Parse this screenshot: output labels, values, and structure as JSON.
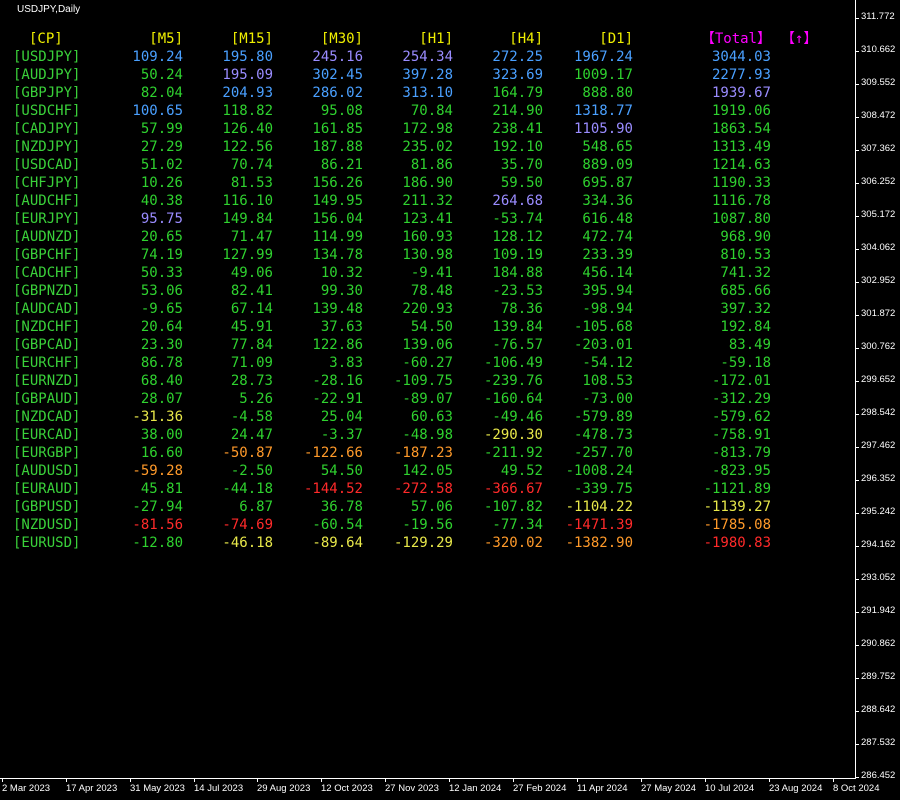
{
  "window": {
    "title": "USDJPY,Daily"
  },
  "colors": {
    "pair": "#3ad13a",
    "hdr_tf": "#f0f000",
    "hdr_total": "#ff00ff",
    "blue": "#4aa0ff",
    "purple": "#9a8cff",
    "green": "#2fd22f",
    "yellow": "#e8e84a",
    "orange": "#ff9a2a",
    "red": "#ff2a2a",
    "axis": "#ffffff"
  },
  "table": {
    "pair_header": "[CP]",
    "headers": [
      "[M5]",
      "[M15]",
      "[M30]",
      "[H1]",
      "[H4]",
      "[D1]",
      "【Total】"
    ],
    "arrow_header": "【↑】",
    "rows": [
      {
        "pair": "[USDJPY]",
        "v": [
          "109.24",
          "195.80",
          "245.16",
          "254.34",
          "272.25",
          "1967.24",
          "3044.03"
        ],
        "c": [
          "blue",
          "blue",
          "purple",
          "purple",
          "blue",
          "blue",
          "blue"
        ]
      },
      {
        "pair": "[AUDJPY]",
        "v": [
          "50.24",
          "195.09",
          "302.45",
          "397.28",
          "323.69",
          "1009.17",
          "2277.93"
        ],
        "c": [
          "green",
          "purple",
          "blue",
          "blue",
          "blue",
          "green",
          "blue"
        ]
      },
      {
        "pair": "[GBPJPY]",
        "v": [
          "82.04",
          "204.93",
          "286.02",
          "313.10",
          "164.79",
          "888.80",
          "1939.67"
        ],
        "c": [
          "green",
          "blue",
          "blue",
          "blue",
          "green",
          "green",
          "purple"
        ]
      },
      {
        "pair": "[USDCHF]",
        "v": [
          "100.65",
          "118.82",
          "95.08",
          "70.84",
          "214.90",
          "1318.77",
          "1919.06"
        ],
        "c": [
          "blue",
          "green",
          "green",
          "green",
          "green",
          "blue",
          "green"
        ]
      },
      {
        "pair": "[CADJPY]",
        "v": [
          "57.99",
          "126.40",
          "161.85",
          "172.98",
          "238.41",
          "1105.90",
          "1863.54"
        ],
        "c": [
          "green",
          "green",
          "green",
          "green",
          "green",
          "purple",
          "green"
        ]
      },
      {
        "pair": "[NZDJPY]",
        "v": [
          "27.29",
          "122.56",
          "187.88",
          "235.02",
          "192.10",
          "548.65",
          "1313.49"
        ],
        "c": [
          "green",
          "green",
          "green",
          "green",
          "green",
          "green",
          "green"
        ]
      },
      {
        "pair": "[USDCAD]",
        "v": [
          "51.02",
          "70.74",
          "86.21",
          "81.86",
          "35.70",
          "889.09",
          "1214.63"
        ],
        "c": [
          "green",
          "green",
          "green",
          "green",
          "green",
          "green",
          "green"
        ]
      },
      {
        "pair": "[CHFJPY]",
        "v": [
          "10.26",
          "81.53",
          "156.26",
          "186.90",
          "59.50",
          "695.87",
          "1190.33"
        ],
        "c": [
          "green",
          "green",
          "green",
          "green",
          "green",
          "green",
          "green"
        ]
      },
      {
        "pair": "[AUDCHF]",
        "v": [
          "40.38",
          "116.10",
          "149.95",
          "211.32",
          "264.68",
          "334.36",
          "1116.78"
        ],
        "c": [
          "green",
          "green",
          "green",
          "green",
          "purple",
          "green",
          "green"
        ]
      },
      {
        "pair": "[EURJPY]",
        "v": [
          "95.75",
          "149.84",
          "156.04",
          "123.41",
          "-53.74",
          "616.48",
          "1087.80"
        ],
        "c": [
          "purple",
          "green",
          "green",
          "green",
          "green",
          "green",
          "green"
        ]
      },
      {
        "pair": "[AUDNZD]",
        "v": [
          "20.65",
          "71.47",
          "114.99",
          "160.93",
          "128.12",
          "472.74",
          "968.90"
        ],
        "c": [
          "green",
          "green",
          "green",
          "green",
          "green",
          "green",
          "green"
        ]
      },
      {
        "pair": "[GBPCHF]",
        "v": [
          "74.19",
          "127.99",
          "134.78",
          "130.98",
          "109.19",
          "233.39",
          "810.53"
        ],
        "c": [
          "green",
          "green",
          "green",
          "green",
          "green",
          "green",
          "green"
        ]
      },
      {
        "pair": "[CADCHF]",
        "v": [
          "50.33",
          "49.06",
          "10.32",
          "-9.41",
          "184.88",
          "456.14",
          "741.32"
        ],
        "c": [
          "green",
          "green",
          "green",
          "green",
          "green",
          "green",
          "green"
        ]
      },
      {
        "pair": "[GBPNZD]",
        "v": [
          "53.06",
          "82.41",
          "99.30",
          "78.48",
          "-23.53",
          "395.94",
          "685.66"
        ],
        "c": [
          "green",
          "green",
          "green",
          "green",
          "green",
          "green",
          "green"
        ]
      },
      {
        "pair": "[AUDCAD]",
        "v": [
          "-9.65",
          "67.14",
          "139.48",
          "220.93",
          "78.36",
          "-98.94",
          "397.32"
        ],
        "c": [
          "green",
          "green",
          "green",
          "green",
          "green",
          "green",
          "green"
        ]
      },
      {
        "pair": "[NZDCHF]",
        "v": [
          "20.64",
          "45.91",
          "37.63",
          "54.50",
          "139.84",
          "-105.68",
          "192.84"
        ],
        "c": [
          "green",
          "green",
          "green",
          "green",
          "green",
          "green",
          "green"
        ]
      },
      {
        "pair": "[GBPCAD]",
        "v": [
          "23.30",
          "77.84",
          "122.86",
          "139.06",
          "-76.57",
          "-203.01",
          "83.49"
        ],
        "c": [
          "green",
          "green",
          "green",
          "green",
          "green",
          "green",
          "green"
        ]
      },
      {
        "pair": "[EURCHF]",
        "v": [
          "86.78",
          "71.09",
          "3.83",
          "-60.27",
          "-106.49",
          "-54.12",
          "-59.18"
        ],
        "c": [
          "green",
          "green",
          "green",
          "green",
          "green",
          "green",
          "green"
        ]
      },
      {
        "pair": "[EURNZD]",
        "v": [
          "68.40",
          "28.73",
          "-28.16",
          "-109.75",
          "-239.76",
          "108.53",
          "-172.01"
        ],
        "c": [
          "green",
          "green",
          "green",
          "green",
          "green",
          "green",
          "green"
        ]
      },
      {
        "pair": "[GBPAUD]",
        "v": [
          "28.07",
          "5.26",
          "-22.91",
          "-89.07",
          "-160.64",
          "-73.00",
          "-312.29"
        ],
        "c": [
          "green",
          "green",
          "green",
          "green",
          "green",
          "green",
          "green"
        ]
      },
      {
        "pair": "[NZDCAD]",
        "v": [
          "-31.36",
          "-4.58",
          "25.04",
          "60.63",
          "-49.46",
          "-579.89",
          "-579.62"
        ],
        "c": [
          "yellow",
          "green",
          "green",
          "green",
          "green",
          "green",
          "green"
        ]
      },
      {
        "pair": "[EURCAD]",
        "v": [
          "38.00",
          "24.47",
          "-3.37",
          "-48.98",
          "-290.30",
          "-478.73",
          "-758.91"
        ],
        "c": [
          "green",
          "green",
          "green",
          "green",
          "yellow",
          "green",
          "green"
        ]
      },
      {
        "pair": "[EURGBP]",
        "v": [
          "16.60",
          "-50.87",
          "-122.66",
          "-187.23",
          "-211.92",
          "-257.70",
          "-813.79"
        ],
        "c": [
          "green",
          "orange",
          "orange",
          "orange",
          "green",
          "green",
          "green"
        ]
      },
      {
        "pair": "[AUDUSD]",
        "v": [
          "-59.28",
          "-2.50",
          "54.50",
          "142.05",
          "49.52",
          "-1008.24",
          "-823.95"
        ],
        "c": [
          "orange",
          "green",
          "green",
          "green",
          "green",
          "green",
          "green"
        ]
      },
      {
        "pair": "[EURAUD]",
        "v": [
          "45.81",
          "-44.18",
          "-144.52",
          "-272.58",
          "-366.67",
          "-339.75",
          "-1121.89"
        ],
        "c": [
          "green",
          "green",
          "red",
          "red",
          "red",
          "green",
          "green"
        ]
      },
      {
        "pair": "[GBPUSD]",
        "v": [
          "-27.94",
          "6.87",
          "36.78",
          "57.06",
          "-107.82",
          "-1104.22",
          "-1139.27"
        ],
        "c": [
          "green",
          "green",
          "green",
          "green",
          "green",
          "yellow",
          "yellow"
        ]
      },
      {
        "pair": "[NZDUSD]",
        "v": [
          "-81.56",
          "-74.69",
          "-60.54",
          "-19.56",
          "-77.34",
          "-1471.39",
          "-1785.08"
        ],
        "c": [
          "red",
          "red",
          "green",
          "green",
          "green",
          "red",
          "orange"
        ]
      },
      {
        "pair": "[EURUSD]",
        "v": [
          "-12.80",
          "-46.18",
          "-89.64",
          "-129.29",
          "-320.02",
          "-1382.90",
          "-1980.83"
        ],
        "c": [
          "green",
          "yellow",
          "yellow",
          "yellow",
          "orange",
          "orange",
          "red"
        ]
      }
    ]
  },
  "price_axis": [
    "311.772",
    "310.662",
    "309.552",
    "308.472",
    "307.362",
    "306.252",
    "305.172",
    "304.062",
    "302.952",
    "301.872",
    "300.762",
    "299.652",
    "298.542",
    "297.462",
    "296.352",
    "295.242",
    "294.162",
    "293.052",
    "291.942",
    "290.862",
    "289.752",
    "288.642",
    "287.532",
    "286.452"
  ],
  "time_axis": [
    "2 Mar 2023",
    "17 Apr 2023",
    "31 May 2023",
    "14 Jul 2023",
    "29 Aug 2023",
    "12 Oct 2023",
    "27 Nov 2023",
    "12 Jan 2024",
    "27 Feb 2024",
    "11 Apr 2024",
    "27 May 2024",
    "10 Jul 2024",
    "23 Aug 2024",
    "8 Oct 2024"
  ]
}
